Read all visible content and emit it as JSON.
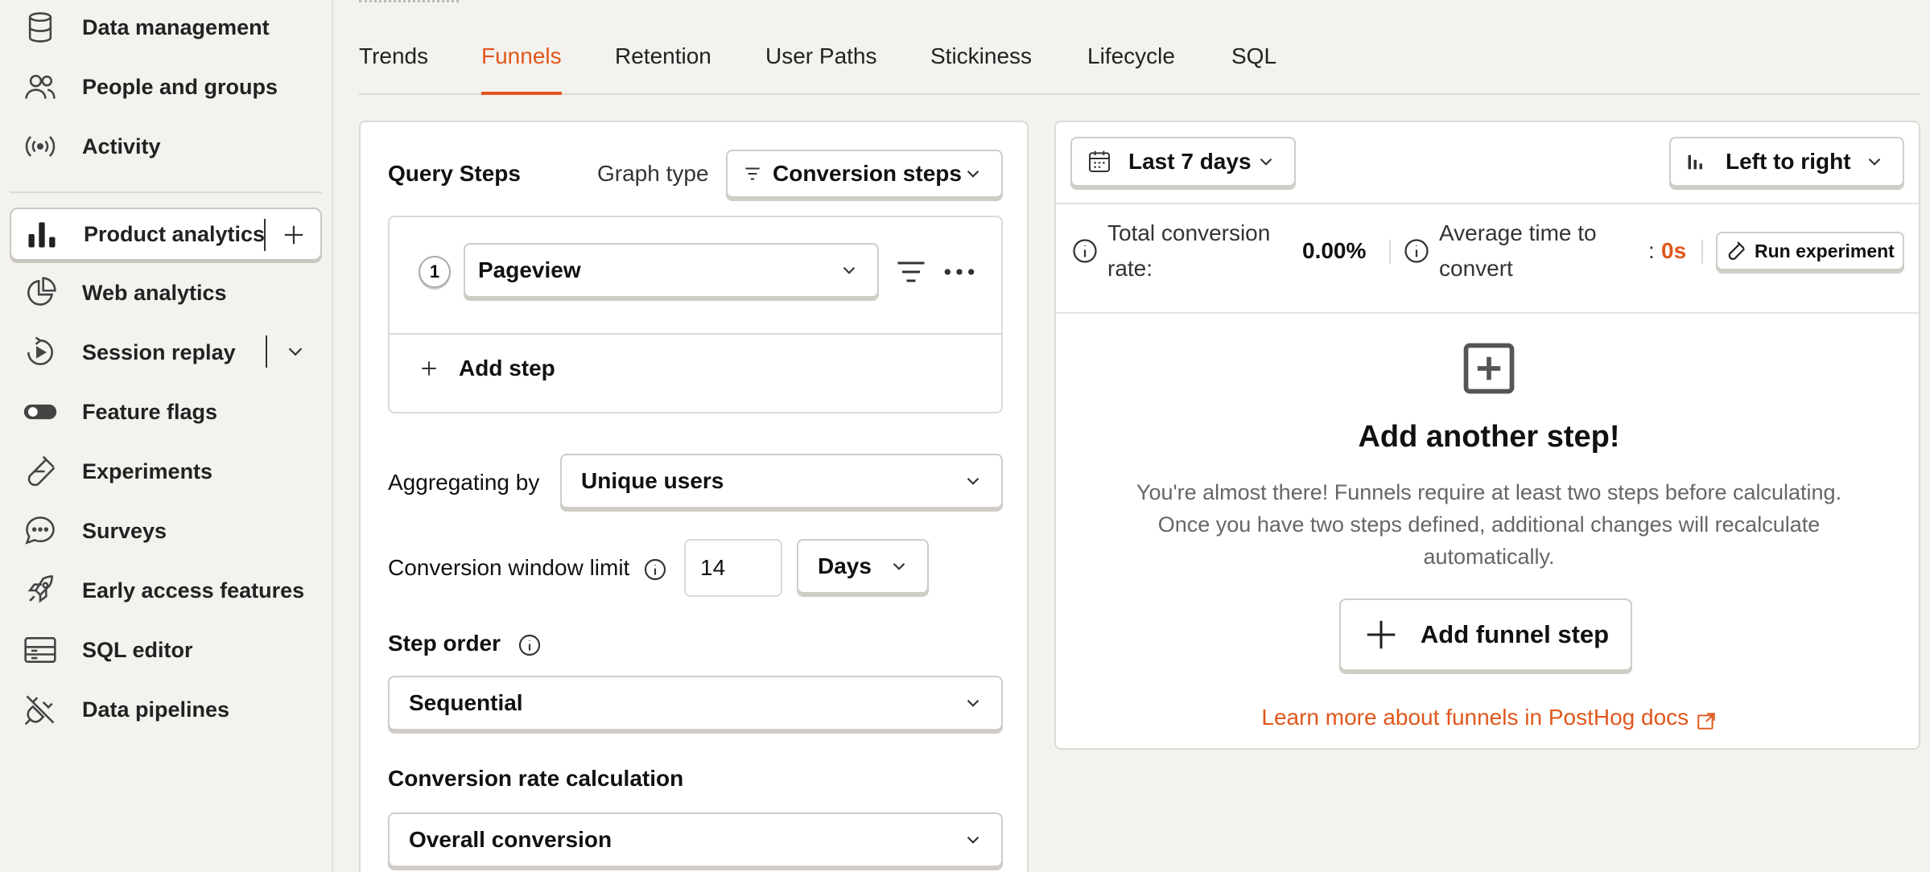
{
  "sidebar": {
    "items": [
      {
        "label": "Data management",
        "icon": "database-icon"
      },
      {
        "label": "People and groups",
        "icon": "people-icon"
      },
      {
        "label": "Activity",
        "icon": "activity-icon"
      },
      {
        "label": "Product analytics",
        "icon": "bar-chart-icon",
        "active": true
      },
      {
        "label": "Web analytics",
        "icon": "pie-chart-icon"
      },
      {
        "label": "Session replay",
        "icon": "replay-icon"
      },
      {
        "label": "Feature flags",
        "icon": "toggle-icon"
      },
      {
        "label": "Experiments",
        "icon": "flask-icon"
      },
      {
        "label": "Surveys",
        "icon": "chat-icon"
      },
      {
        "label": "Early access features",
        "icon": "rocket-icon"
      },
      {
        "label": "SQL editor",
        "icon": "table-icon"
      },
      {
        "label": "Data pipelines",
        "icon": "plug-icon"
      }
    ]
  },
  "tabs": [
    "Trends",
    "Funnels",
    "Retention",
    "User Paths",
    "Stickiness",
    "Lifecycle",
    "SQL"
  ],
  "active_tab": "Funnels",
  "query": {
    "title": "Query Steps",
    "graph_type_label": "Graph type",
    "graph_type_value": "Conversion steps",
    "step_number": "1",
    "step_event": "Pageview",
    "add_step_label": "Add step",
    "aggregating_label": "Aggregating by",
    "aggregating_value": "Unique users",
    "window_label": "Conversion window limit",
    "window_value": "14",
    "window_unit": "Days",
    "step_order_label": "Step order",
    "step_order_value": "Sequential",
    "conversion_calc_label": "Conversion rate calculation",
    "conversion_calc_value": "Overall conversion"
  },
  "results": {
    "date_range": "Last 7 days",
    "layout": "Left to right",
    "total_conversion_label_1": "Total conversion",
    "total_conversion_label_2": "rate:",
    "total_conversion_value": "0.00%",
    "avg_time_label_1": "Average time to",
    "avg_time_label_2": "convert",
    "avg_time_colon": ":",
    "avg_time_value": "0s",
    "run_experiment_label": "Run experiment",
    "empty_title": "Add another step!",
    "empty_desc_1": "You're almost there! Funnels require at least two steps before calculating.",
    "empty_desc_2": "Once you have two steps defined, additional changes will recalculate",
    "empty_desc_3": "automatically.",
    "add_funnel_step_label": "Add funnel step",
    "docs_link": "Learn more about funnels in PostHog docs"
  },
  "colors": {
    "accent": "#e0571c",
    "background": "#f3f2ee"
  }
}
